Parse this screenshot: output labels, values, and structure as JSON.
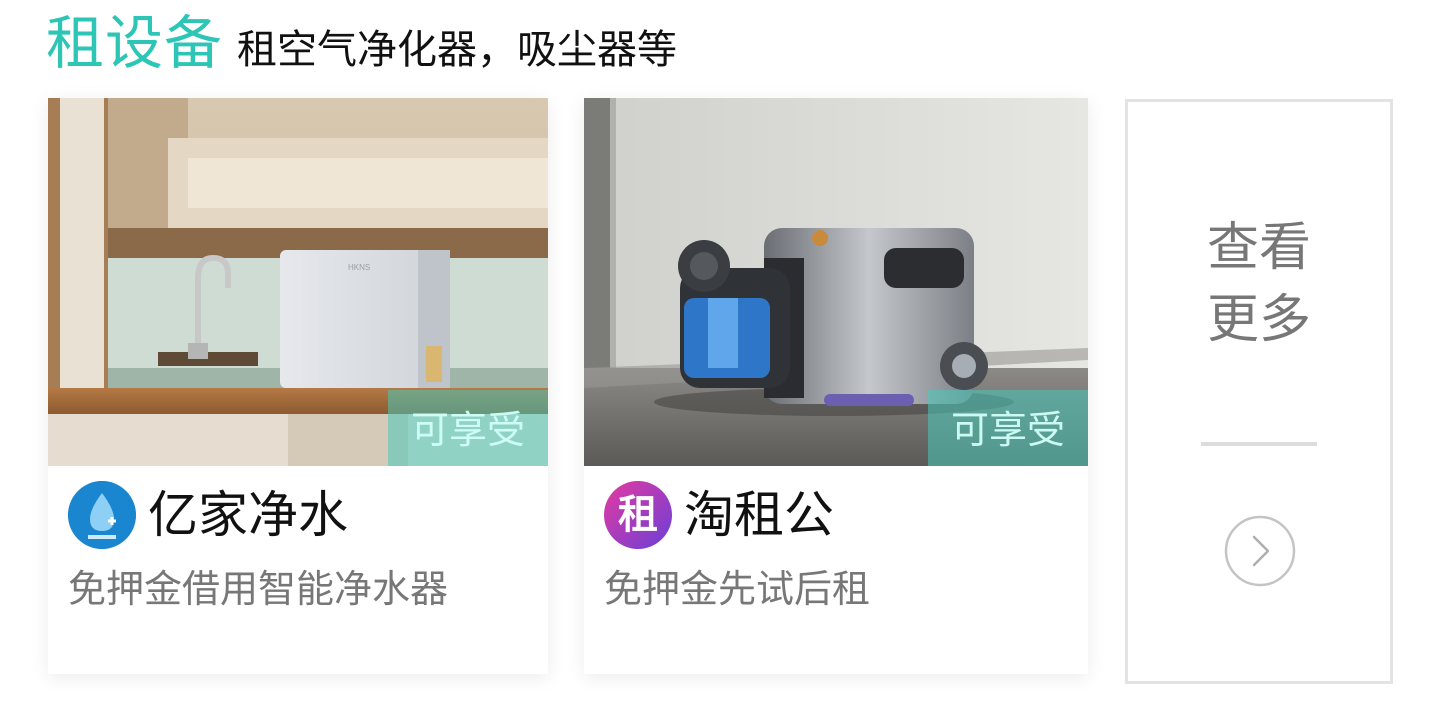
{
  "header": {
    "title": "租设备",
    "subtitle": "租空气净化器，吸尘器等"
  },
  "colors": {
    "accent": "#2cc5b6",
    "promo_tag_bg": "#48c9ba",
    "text_primary": "#111111",
    "text_secondary": "#777777"
  },
  "cards": [
    {
      "image": "water-purifier-kitchen-photo",
      "tag": "可享受",
      "brand_logo": "water-drop-logo",
      "brand_name": "亿家净水",
      "description": "免押金借用智能净水器"
    },
    {
      "image": "robot-vacuum-photo",
      "tag": "可享受",
      "brand_logo": "zu-character-logo",
      "brand_logo_text": "租",
      "brand_name": "淘租公",
      "description": "免押金先试后租"
    }
  ],
  "more": {
    "line1": "查看",
    "line2": "更多",
    "icon": "chevron-right-circle-icon"
  }
}
